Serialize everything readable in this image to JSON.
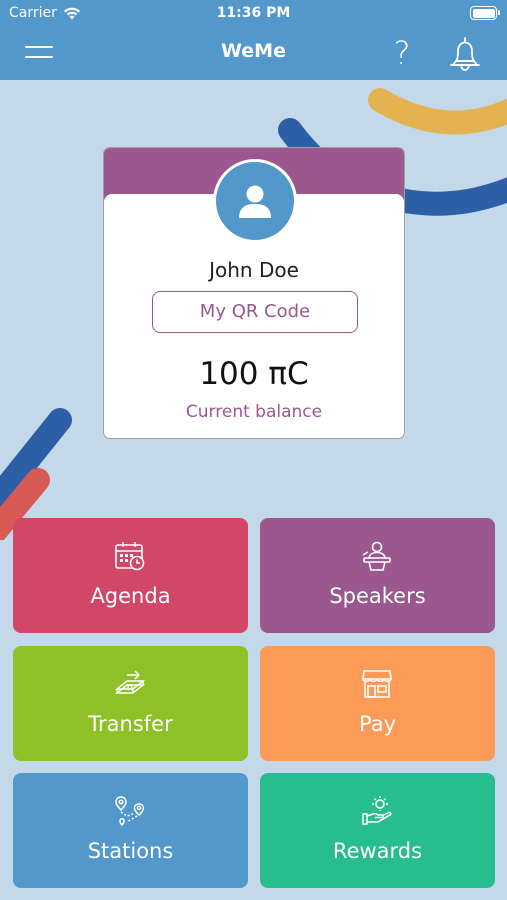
{
  "status": {
    "carrier": "Carrier",
    "time": "11:36 PM"
  },
  "nav": {
    "title": "WeMe",
    "help_symbol": "?"
  },
  "profile": {
    "name": "John Doe",
    "qr_button": "My QR Code",
    "balance": "100 πC",
    "balance_label": "Current balance"
  },
  "tiles": [
    {
      "label": "Agenda",
      "icon": "calendar-icon",
      "color": "#d24768"
    },
    {
      "label": "Speakers",
      "icon": "speaker-podium-icon",
      "color": "#9a588e"
    },
    {
      "label": "Transfer",
      "icon": "money-transfer-icon",
      "color": "#8ec027"
    },
    {
      "label": "Pay",
      "icon": "store-icon",
      "color": "#fc9a57"
    },
    {
      "label": "Stations",
      "icon": "map-route-icon",
      "color": "#5398ca"
    },
    {
      "label": "Rewards",
      "icon": "hand-reward-icon",
      "color": "#27bd8c"
    }
  ],
  "colors": {
    "header": "#5398ca",
    "background": "#c3d9e9",
    "accent_purple": "#9a588e"
  }
}
